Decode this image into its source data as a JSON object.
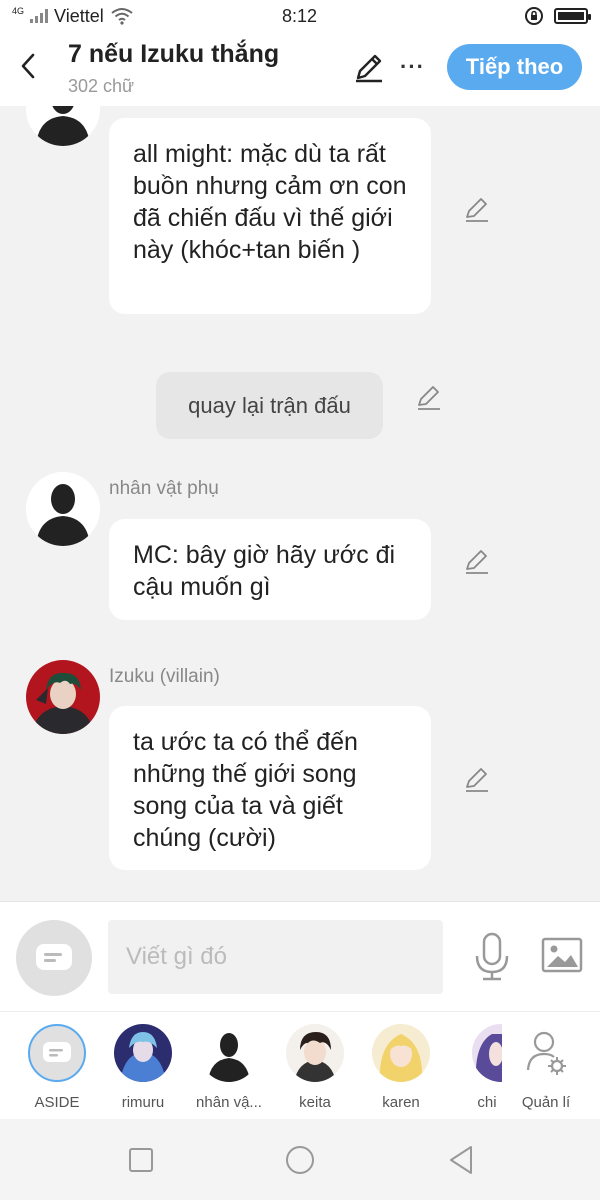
{
  "status_bar": {
    "network": "4G",
    "carrier": "Viettel",
    "time": "8:12"
  },
  "header": {
    "title": "7 nếu Izuku thắng",
    "word_count": "302 chữ",
    "more_label": "···",
    "next_label": "Tiếp theo"
  },
  "messages": {
    "m1": {
      "text": "all might: mặc dù ta rất buồn nhưng cảm ơn con đã chiến đấu vì thế giới này (khóc+tan biến )"
    },
    "narration": {
      "text": "quay lại trận đấu"
    },
    "m2": {
      "speaker": "nhân vật phụ",
      "text": "MC: bây giờ hãy ước đi cậu muốn gì"
    },
    "m3": {
      "speaker": "Izuku (villain)",
      "text": "ta ước ta có thể đến những thế giới song song của ta và giết chúng (cười)"
    }
  },
  "input": {
    "placeholder": "Viết gì đó"
  },
  "characters": {
    "aside": "ASIDE",
    "rimuru": "rimuru",
    "npc": "nhân vậ...",
    "keita": "keita",
    "karen": "karen",
    "chi": "chi",
    "manage": "Quản lí"
  },
  "colors": {
    "accent": "#5aaaf0",
    "background": "#f2f2f2"
  }
}
